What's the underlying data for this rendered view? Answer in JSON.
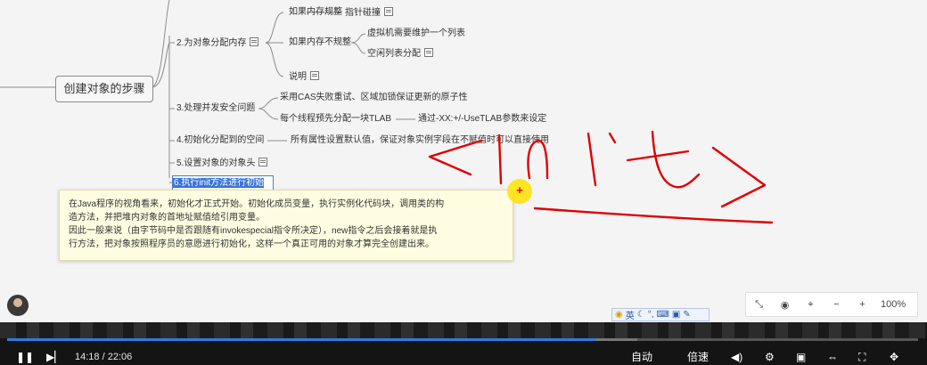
{
  "mindmap": {
    "root": "创建对象的步骤",
    "steps": [
      {
        "label": "2.为对象分配内存"
      },
      {
        "label": "3.处理并发安全问题"
      },
      {
        "label": "4.初始化分配到的空间"
      },
      {
        "label": "5.设置对象的对象头"
      },
      {
        "label": "6.执行init方法进行初始化"
      }
    ],
    "step2_children": {
      "regular": "如果内存规整",
      "pointer_bump": "指针碰撞",
      "irregular": "如果内存不规整",
      "maintain_list": "虚拟机需要维护一个列表",
      "free_list": "空闲列表分配",
      "note": "说明"
    },
    "step3_children": {
      "cas": "采用CAS失败重试、区域加锁保证更新的原子性",
      "tlab": "每个线程预先分配一块TLAB",
      "tlab_param": "通过-XX:+/-UseTLAB参数来设定"
    },
    "step4_child": "所有属性设置默认值，保证对象实例字段在不赋值时可以直接使用"
  },
  "tooltip": {
    "lines": [
      "在Java程序的视角看来，初始化才正式开始。初始化成员变量，执行实例化代码块，调用类的构",
      "造方法，并把堆内对象的首地址赋值给引用变量。",
      "因此一般来说（由字节码中是否跟随有invokespecial指令所决定），new指令之后会接着就是执",
      "行方法，把对象按照程序员的意愿进行初始化，这样一个真正可用的对象才算完全创建出来。"
    ]
  },
  "cursor_mark": "+",
  "zoom": {
    "level": "100%",
    "icons": [
      "fit-icon",
      "eye-icon",
      "location-icon",
      "zoom-out-icon",
      "zoom-in-icon"
    ]
  },
  "ime": {
    "label": "英"
  },
  "player": {
    "current_time": "14:18",
    "separator": "/",
    "total_time": "22:06",
    "progress": 0.647,
    "quality_label": "自动",
    "speed_label": "倍速"
  },
  "colors": {
    "accent": "#2f7be0",
    "selection": "#3b74d8",
    "annotation": "#e00000",
    "tooltip_bg": "#fffde1"
  }
}
